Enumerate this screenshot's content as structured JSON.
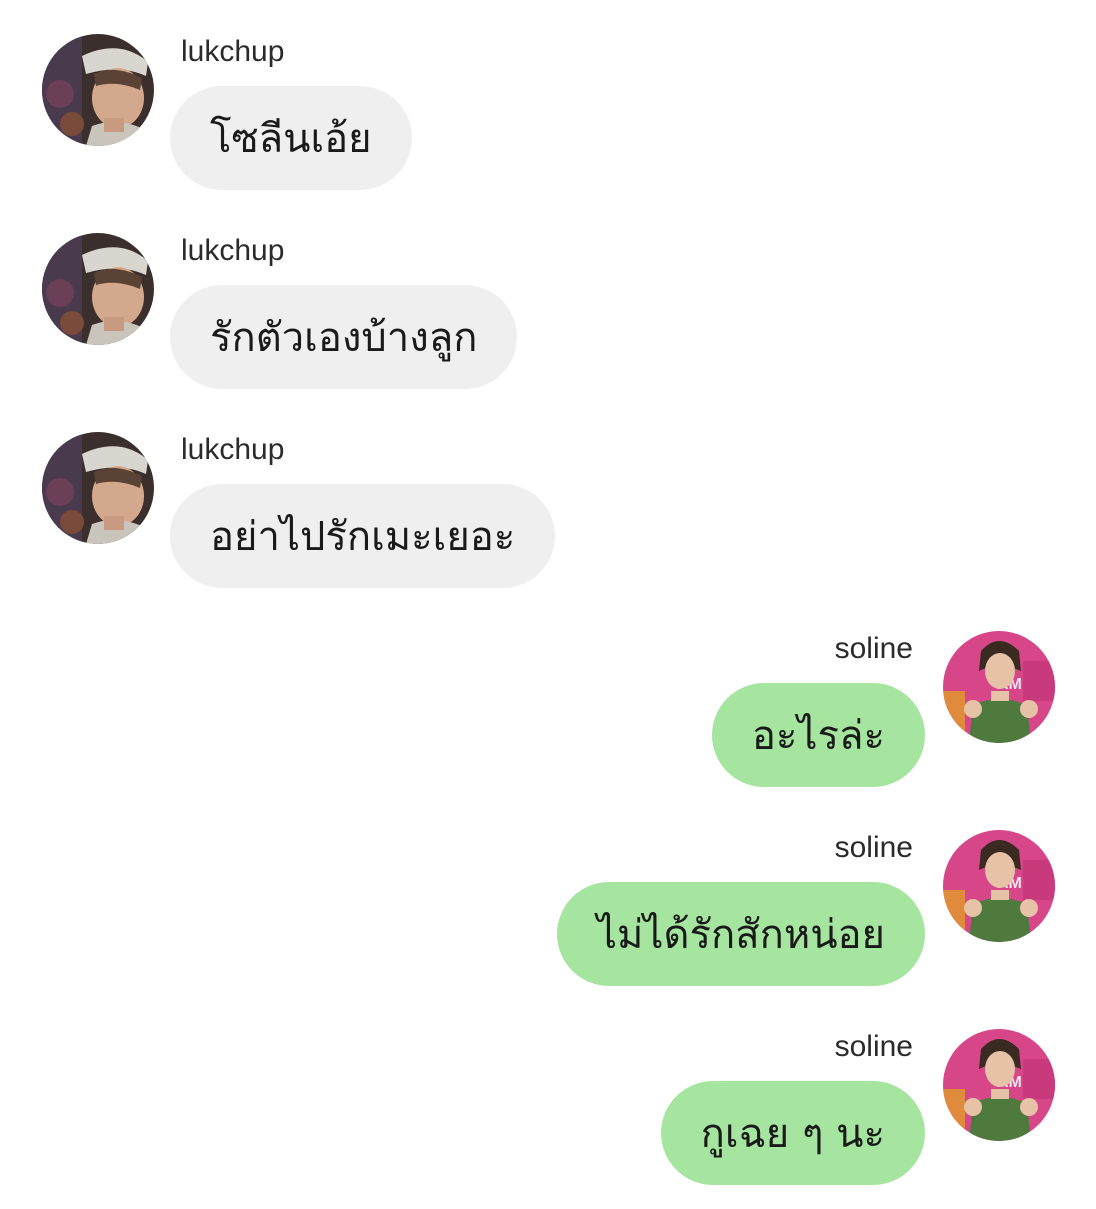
{
  "messages": [
    {
      "sender": "lukchup",
      "text": "โซลีนเอ้ย",
      "avatar": "lukchup-avatar-photo"
    },
    {
      "sender": "lukchup",
      "text": "รักตัวเองบ้างลูก",
      "avatar": "lukchup-avatar-photo"
    },
    {
      "sender": "lukchup",
      "text": "อย่าไปรักเมะเยอะ",
      "avatar": "lukchup-avatar-photo"
    },
    {
      "sender": "soline",
      "text": "อะไรล่ะ",
      "avatar": "soline-avatar-photo"
    },
    {
      "sender": "soline",
      "text": "ไม่ได้รักสักหน่อย",
      "avatar": "soline-avatar-photo"
    },
    {
      "sender": "soline",
      "text": "กูเฉย ๆ นะ",
      "avatar": "soline-avatar-photo"
    }
  ],
  "colors": {
    "incoming_bubble": "#efefef",
    "outgoing_bubble": "#a5e5a0",
    "text": "#1a1a1a",
    "name_text": "#2b2b2b",
    "background": "#ffffff"
  }
}
